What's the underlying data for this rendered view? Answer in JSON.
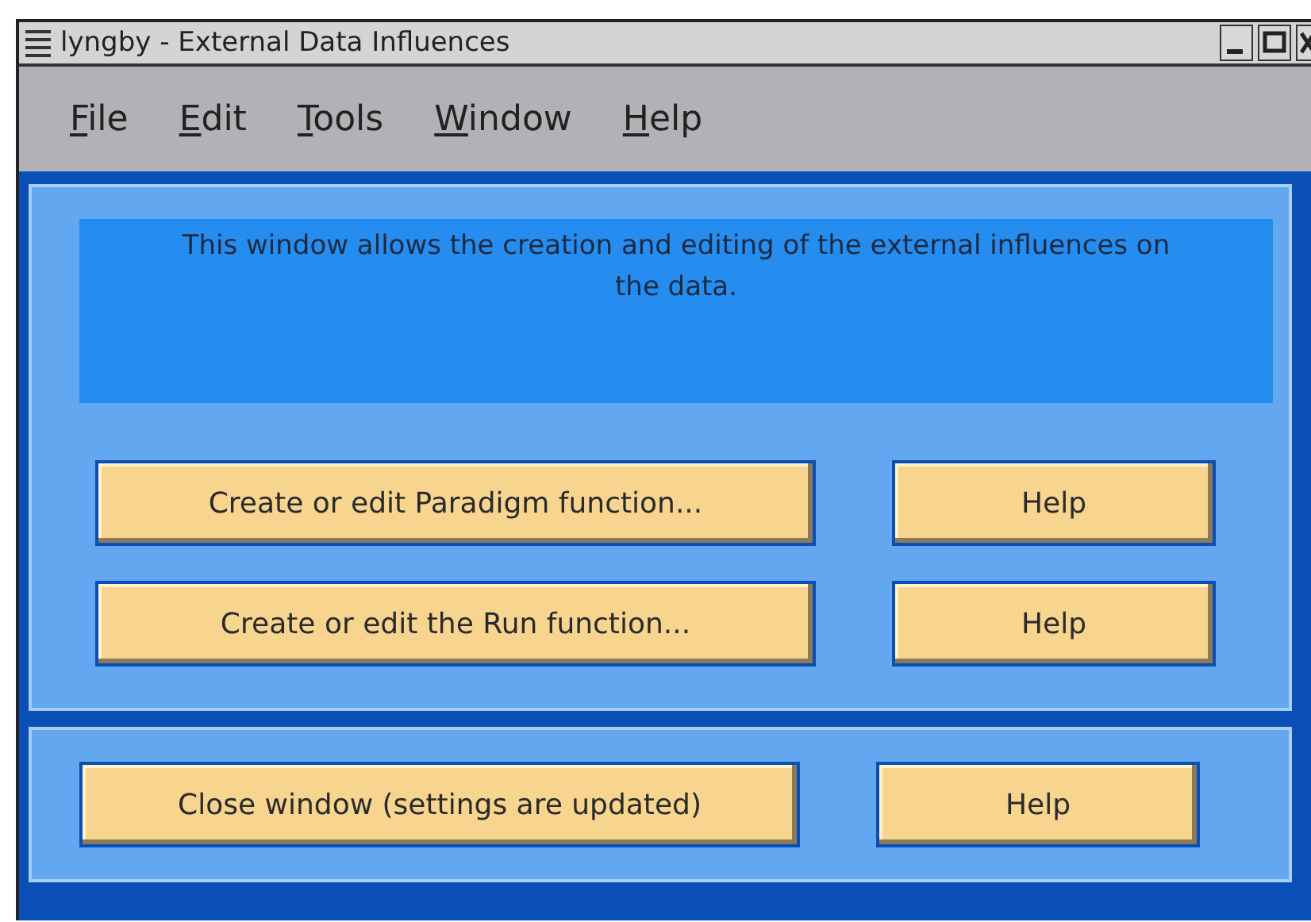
{
  "window": {
    "title": "lyngby - External Data Influences"
  },
  "menu": [
    {
      "label": "File"
    },
    {
      "label": "Edit"
    },
    {
      "label": "Tools"
    },
    {
      "label": "Window"
    },
    {
      "label": "Help"
    }
  ],
  "message": "This window allows the creation and editing of the external influences on the data.",
  "panels": [
    {
      "rows": [
        {
          "action": "Create or edit Paradigm function...",
          "help": "Help"
        },
        {
          "action": "Create or edit the Run function...",
          "help": "Help"
        }
      ]
    },
    {
      "rows": [
        {
          "action": "Close window (settings are updated)",
          "help": "Help"
        }
      ]
    }
  ]
}
